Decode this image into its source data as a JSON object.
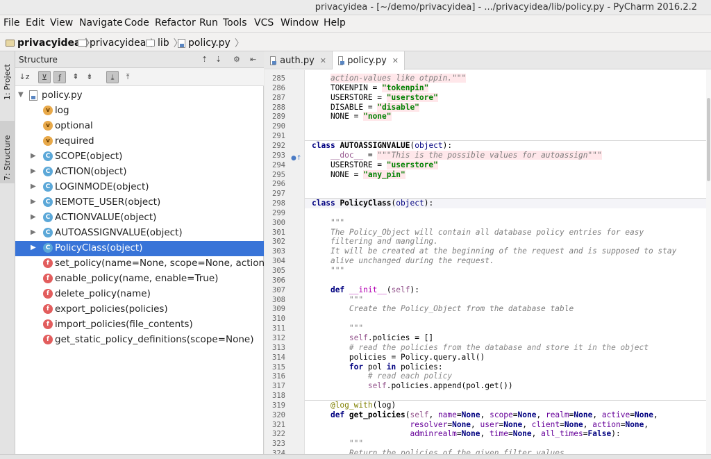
{
  "window": {
    "title": "privacyidea - [~/demo/privacyidea] - .../privacyidea/lib/policy.py - PyCharm 2016.2.2"
  },
  "menu": [
    "File",
    "Edit",
    "View",
    "Navigate",
    "Code",
    "Refactor",
    "Run",
    "Tools",
    "VCS",
    "Window",
    "Help"
  ],
  "breadcrumb": [
    "privacyidea",
    "privacyidea",
    "lib",
    "policy.py"
  ],
  "left_tabs": [
    "1: Project",
    "7: Structure"
  ],
  "structure": {
    "title": "Structure",
    "root": "policy.py",
    "items": [
      {
        "kind": "v",
        "label": "log",
        "expandable": false
      },
      {
        "kind": "v",
        "label": "optional",
        "expandable": false
      },
      {
        "kind": "v",
        "label": "required",
        "expandable": false
      },
      {
        "kind": "c",
        "label": "SCOPE(object)",
        "expandable": true
      },
      {
        "kind": "c",
        "label": "ACTION(object)",
        "expandable": true
      },
      {
        "kind": "c",
        "label": "LOGINMODE(object)",
        "expandable": true
      },
      {
        "kind": "c",
        "label": "REMOTE_USER(object)",
        "expandable": true
      },
      {
        "kind": "c",
        "label": "ACTIONVALUE(object)",
        "expandable": true
      },
      {
        "kind": "c",
        "label": "AUTOASSIGNVALUE(object)",
        "expandable": true
      },
      {
        "kind": "c",
        "label": "PolicyClass(object)",
        "expandable": true,
        "selected": true
      },
      {
        "kind": "f",
        "label": "set_policy(name=None, scope=None, action=No",
        "expandable": false
      },
      {
        "kind": "f",
        "label": "enable_policy(name, enable=True)",
        "expandable": false
      },
      {
        "kind": "f",
        "label": "delete_policy(name)",
        "expandable": false
      },
      {
        "kind": "f",
        "label": "export_policies(policies)",
        "expandable": false
      },
      {
        "kind": "f",
        "label": "import_policies(file_contents)",
        "expandable": false
      },
      {
        "kind": "f",
        "label": "get_static_policy_definitions(scope=None)",
        "expandable": false
      }
    ]
  },
  "editor": {
    "tabs": [
      {
        "label": "auth.py",
        "active": false
      },
      {
        "label": "policy.py",
        "active": true
      }
    ],
    "lines": [
      {
        "n": "285",
        "html": "    <span class=\"doc strbg\">action-values like otppin.\"\"\"</span>"
      },
      {
        "n": "286",
        "html": "    TOKENPIN = <span class=\"str strbg\">\"tokenpin\"</span>"
      },
      {
        "n": "287",
        "html": "    USERSTORE = <span class=\"str strbg\">\"userstore\"</span>"
      },
      {
        "n": "288",
        "html": "    DISABLE = <span class=\"str strbg\">\"disable\"</span>"
      },
      {
        "n": "289",
        "html": "    NONE = <span class=\"str strbg\">\"none\"</span>"
      },
      {
        "n": "290",
        "html": ""
      },
      {
        "n": "291",
        "html": ""
      },
      {
        "n": "292",
        "html": "<span class=\"kw\">class</span> <span class=\"cls\">AUTOASSIGNVALUE</span>(<span class=\"builtin\">object</span>):",
        "sep": true
      },
      {
        "n": "293",
        "html": "    <span class=\"self\">__doc__</span> = <span class=\"doc strbg\">\"\"\"This is the possible values for autoassign\"\"\"</span>"
      },
      {
        "n": "294",
        "html": "    USERSTORE = <span class=\"str strbg\">\"userstore\"</span>"
      },
      {
        "n": "295",
        "html": "    NONE = <span class=\"str strbg\">\"any_pin\"</span>"
      },
      {
        "n": "296",
        "html": ""
      },
      {
        "n": "297",
        "html": ""
      },
      {
        "n": "298",
        "html": "<span class=\"kw\">class</span> <span class=\"cls\">PolicyClass</span>(<span class=\"builtin\">object</span>):",
        "sep": true,
        "caret": true
      },
      {
        "n": "299",
        "html": ""
      },
      {
        "n": "300",
        "html": "    <span class=\"doc\">\"\"\"</span>"
      },
      {
        "n": "301",
        "html": "    <span class=\"doc\">The Policy_Object will contain all database policy entries for easy</span>"
      },
      {
        "n": "302",
        "html": "    <span class=\"doc\">filtering and mangling.</span>"
      },
      {
        "n": "303",
        "html": "    <span class=\"doc\">It will be created at the beginning of the request and is supposed to stay</span>"
      },
      {
        "n": "304",
        "html": "    <span class=\"doc\">alive unchanged during the request.</span>"
      },
      {
        "n": "305",
        "html": "    <span class=\"doc\">\"\"\"</span>"
      },
      {
        "n": "306",
        "html": ""
      },
      {
        "n": "307",
        "html": "    <span class=\"kw\">def</span> <span class=\"fn\" style=\"color:#b200b2;font-weight:normal\">__init__</span>(<span class=\"self\">self</span>):"
      },
      {
        "n": "308",
        "html": "        <span class=\"doc\">\"\"\"</span>"
      },
      {
        "n": "309",
        "html": "        <span class=\"doc\">Create the Policy_Object from the database table</span>"
      },
      {
        "n": "310",
        "html": ""
      },
      {
        "n": "311",
        "html": "        <span class=\"doc\">\"\"\"</span>"
      },
      {
        "n": "312",
        "html": "        <span class=\"self\">self</span>.policies = []"
      },
      {
        "n": "313",
        "html": "        <span class=\"cm\"># read the policies from the database and store it in the object</span>"
      },
      {
        "n": "314",
        "html": "        policies = Policy.query.all()"
      },
      {
        "n": "315",
        "html": "        <span class=\"kw\">for</span> pol <span class=\"kw\">in</span> policies:"
      },
      {
        "n": "316",
        "html": "            <span class=\"cm\"># read each policy</span>"
      },
      {
        "n": "317",
        "html": "            <span class=\"self\">self</span>.policies.append(pol.get())"
      },
      {
        "n": "318",
        "html": ""
      },
      {
        "n": "319",
        "html": "    <span class=\"dec\">@log_with</span>(log)",
        "sep": true
      },
      {
        "n": "320",
        "html": "    <span class=\"kw\">def</span> <span class=\"fn\">get_policies</span>(<span class=\"self\">self</span>, <span class=\"kwarg\">name</span>=<span class=\"kw\">None</span>, <span class=\"kwarg\">scope</span>=<span class=\"kw\">None</span>, <span class=\"kwarg\">realm</span>=<span class=\"kw\">None</span>, <span class=\"kwarg\">active</span>=<span class=\"kw\">None</span>,"
      },
      {
        "n": "321",
        "html": "                     <span class=\"kwarg\">resolver</span>=<span class=\"kw\">None</span>, <span class=\"kwarg\">user</span>=<span class=\"kw\">None</span>, <span class=\"kwarg\">client</span>=<span class=\"kw\">None</span>, <span class=\"kwarg\">action</span>=<span class=\"kw\">None</span>,"
      },
      {
        "n": "322",
        "html": "                     <span class=\"kwarg\">adminrealm</span>=<span class=\"kw\">None</span>, <span class=\"kwarg\">time</span>=<span class=\"kw\">None</span>, <span class=\"kwarg\">all_times</span>=<span class=\"kw\">False</span>):"
      },
      {
        "n": "323",
        "html": "        <span class=\"doc\">\"\"\"</span>"
      },
      {
        "n": "324",
        "html": "        <span class=\"doc\">Return the policies of the given filter values</span>"
      }
    ]
  }
}
